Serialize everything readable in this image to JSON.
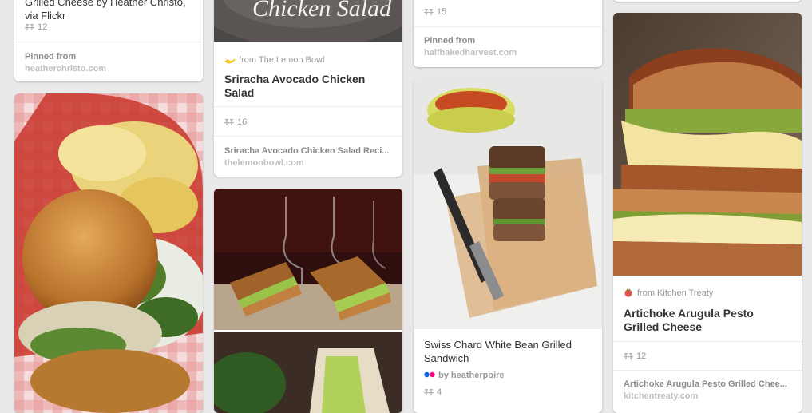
{
  "col1": {
    "card_top": {
      "description_lines": [
        "Grilled Cheese by Heather Christo,",
        "via Flickr"
      ],
      "repins": "12",
      "pinned_label": "Pinned from",
      "source": "heatherchristo.com"
    }
  },
  "col2": {
    "card_top": {
      "image_caption": "Chicken Salad",
      "from_label": "from The Lemon Bowl",
      "title": "Sriracha Avocado Chicken Salad",
      "repins": "16",
      "board_title": "Sriracha Avocado Chicken Salad Reci...",
      "source": "thelemonbowl.com"
    }
  },
  "col3": {
    "card_top": {
      "repins": "15",
      "pinned_label": "Pinned from",
      "source": "halfbakedharvest.com"
    },
    "card_sandwich": {
      "description": "Swiss Chard White Bean Grilled Sandwich",
      "by_label": "by heatherpoire",
      "repins": "4"
    }
  },
  "col4": {
    "card_artichoke": {
      "from_label": "from Kitchen Treaty",
      "title": "Artichoke Arugula Pesto Grilled Cheese",
      "repins": "12",
      "board_title": "Artichoke Arugula Pesto Grilled Chee...",
      "source": "kitchentreaty.com"
    }
  },
  "colors": {
    "background": "#e9e9e9",
    "card": "#ffffff",
    "muted_text": "#999999",
    "source_text": "#c0c0c0",
    "lemon_icon": "#f2c400",
    "flickr_blue": "#0063dc",
    "flickr_pink": "#ff0084",
    "tomato_icon": "#e2574c"
  },
  "icons": [
    "repin-icon",
    "lemon-icon",
    "flickr-icon",
    "tomato-icon"
  ]
}
